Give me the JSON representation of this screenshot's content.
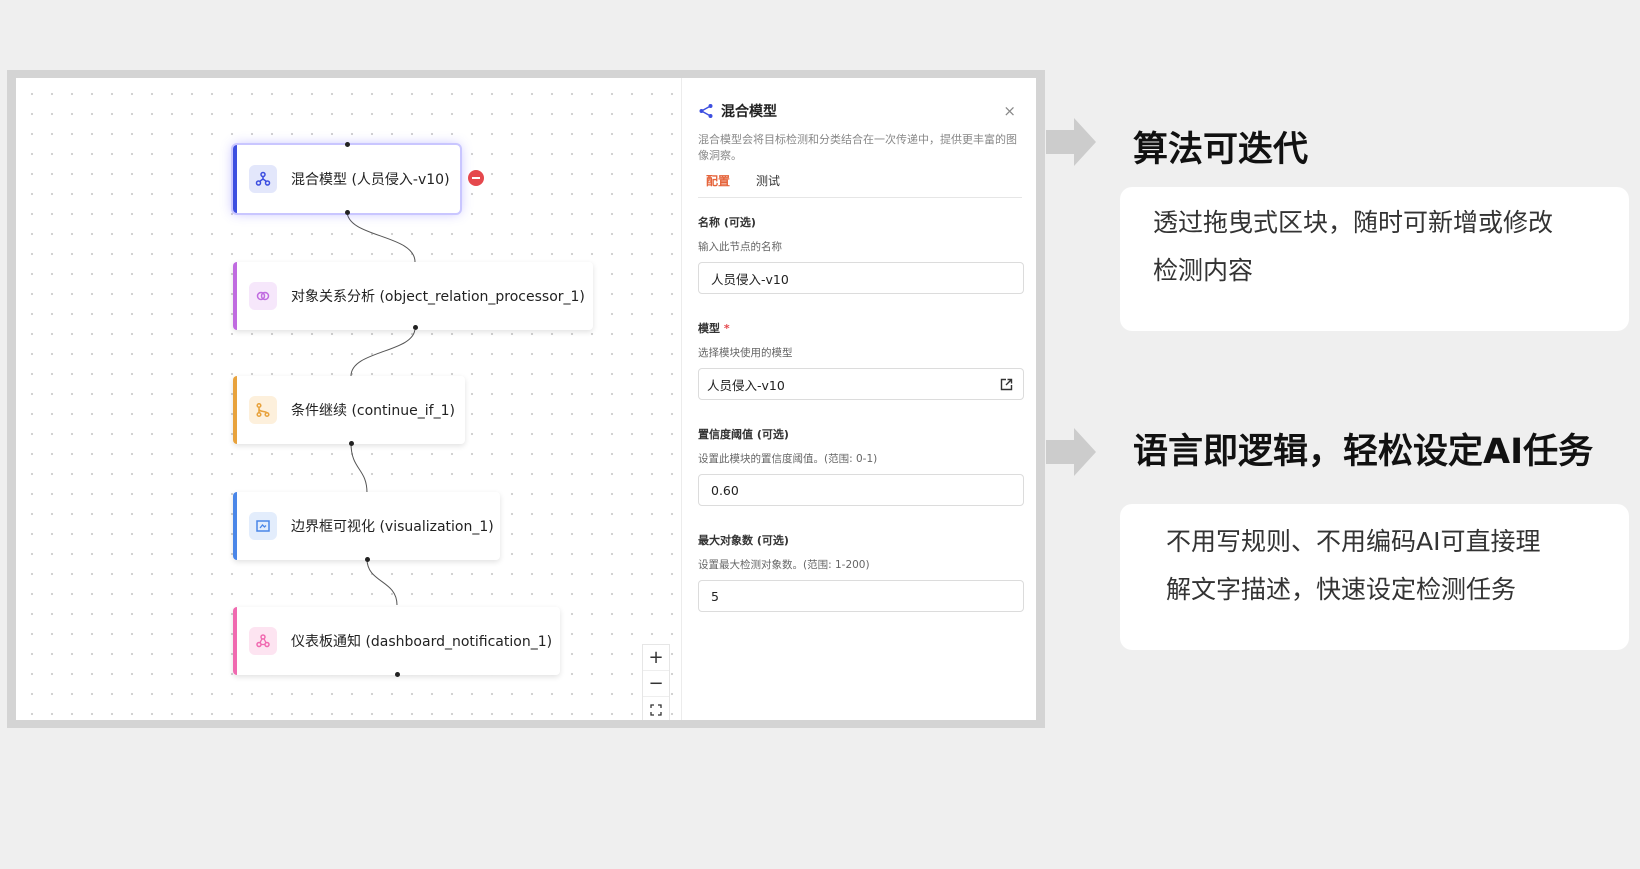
{
  "canvas": {
    "nodes": [
      {
        "label": "混合模型 (人员侵入-v10)",
        "icon": "model-icon",
        "color": "#3d4fe0"
      },
      {
        "label": "对象关系分析 (object_relation_processor_1)",
        "icon": "link-icon",
        "color": "#c06be0"
      },
      {
        "label": "条件继续 (continue_if_1)",
        "icon": "branch-icon",
        "color": "#e8a23c"
      },
      {
        "label": "边界框可视化 (visualization_1)",
        "icon": "bounding-box-icon",
        "color": "#4a86e8"
      },
      {
        "label": "仪表板通知 (dashboard_notification_1)",
        "icon": "webhook-icon",
        "color": "#f06ab0"
      }
    ],
    "zoom_in": "+",
    "zoom_out": "−"
  },
  "panel": {
    "title": "混合模型",
    "close": "×",
    "description": "混合模型会将目标检测和分类结合在一次传递中，提供更丰富的图像洞察。",
    "tabs": [
      "配置",
      "测试"
    ],
    "name_label": "名称 (可选)",
    "name_hint": "输入此节点的名称",
    "name_value": "人员侵入-v10",
    "model_label": "模型",
    "model_required": "*",
    "model_hint": "选择模块使用的模型",
    "model_value": "人员侵入-v10",
    "threshold_label": "置信度阈值 (可选)",
    "threshold_hint": "设置此模块的置信度阈值。(范围: 0-1)",
    "threshold_value": "0.60",
    "max_label": "最大对象数 (可选)",
    "max_hint": "设置最大检测对象数。(范围: 1-200)",
    "max_value": "5"
  },
  "features": [
    {
      "title": "算法可迭代",
      "lines": [
        "透过拖曳式区块，随时可新增或修改",
        "检测内容"
      ]
    },
    {
      "title": "语言即逻辑，轻松设定AI任务",
      "lines": [
        "不用写规则、不用编码AI可直接理",
        "解文字描述，快速设定检测任务"
      ]
    }
  ],
  "colors": {
    "accent": "#e5643b",
    "arrow": "#cccccc",
    "selected_glow": "#c9c6ff"
  }
}
